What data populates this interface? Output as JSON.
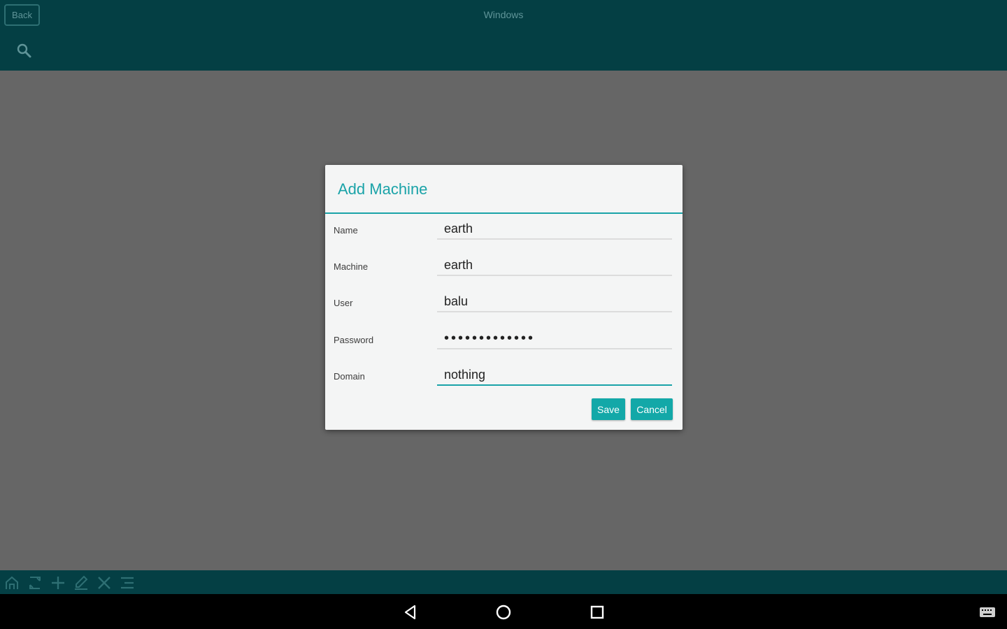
{
  "appbar": {
    "back_label": "Back",
    "title": "Windows",
    "search_icon": "search-icon"
  },
  "dialog": {
    "title": "Add Machine",
    "fields": [
      {
        "label": "Name",
        "value": "earth"
      },
      {
        "label": "Machine",
        "value": "earth"
      },
      {
        "label": "User",
        "value": "balu"
      },
      {
        "label": "Password",
        "value": "•••••••••••••"
      },
      {
        "label": "Domain",
        "value": "nothing"
      }
    ],
    "save_label": "Save",
    "cancel_label": "Cancel"
  },
  "toolbar": {
    "icons": [
      "home-icon",
      "refresh-icon",
      "add-icon",
      "edit-icon",
      "delete-icon",
      "menu-icon"
    ]
  },
  "navbar": {
    "icons": [
      "back-nav-icon",
      "home-nav-icon",
      "recents-nav-icon",
      "keyboard-icon"
    ]
  },
  "colors": {
    "appbar": "#043f44",
    "accent": "#1aa3a8",
    "button": "#13a8a8",
    "overlay": "#666666"
  }
}
